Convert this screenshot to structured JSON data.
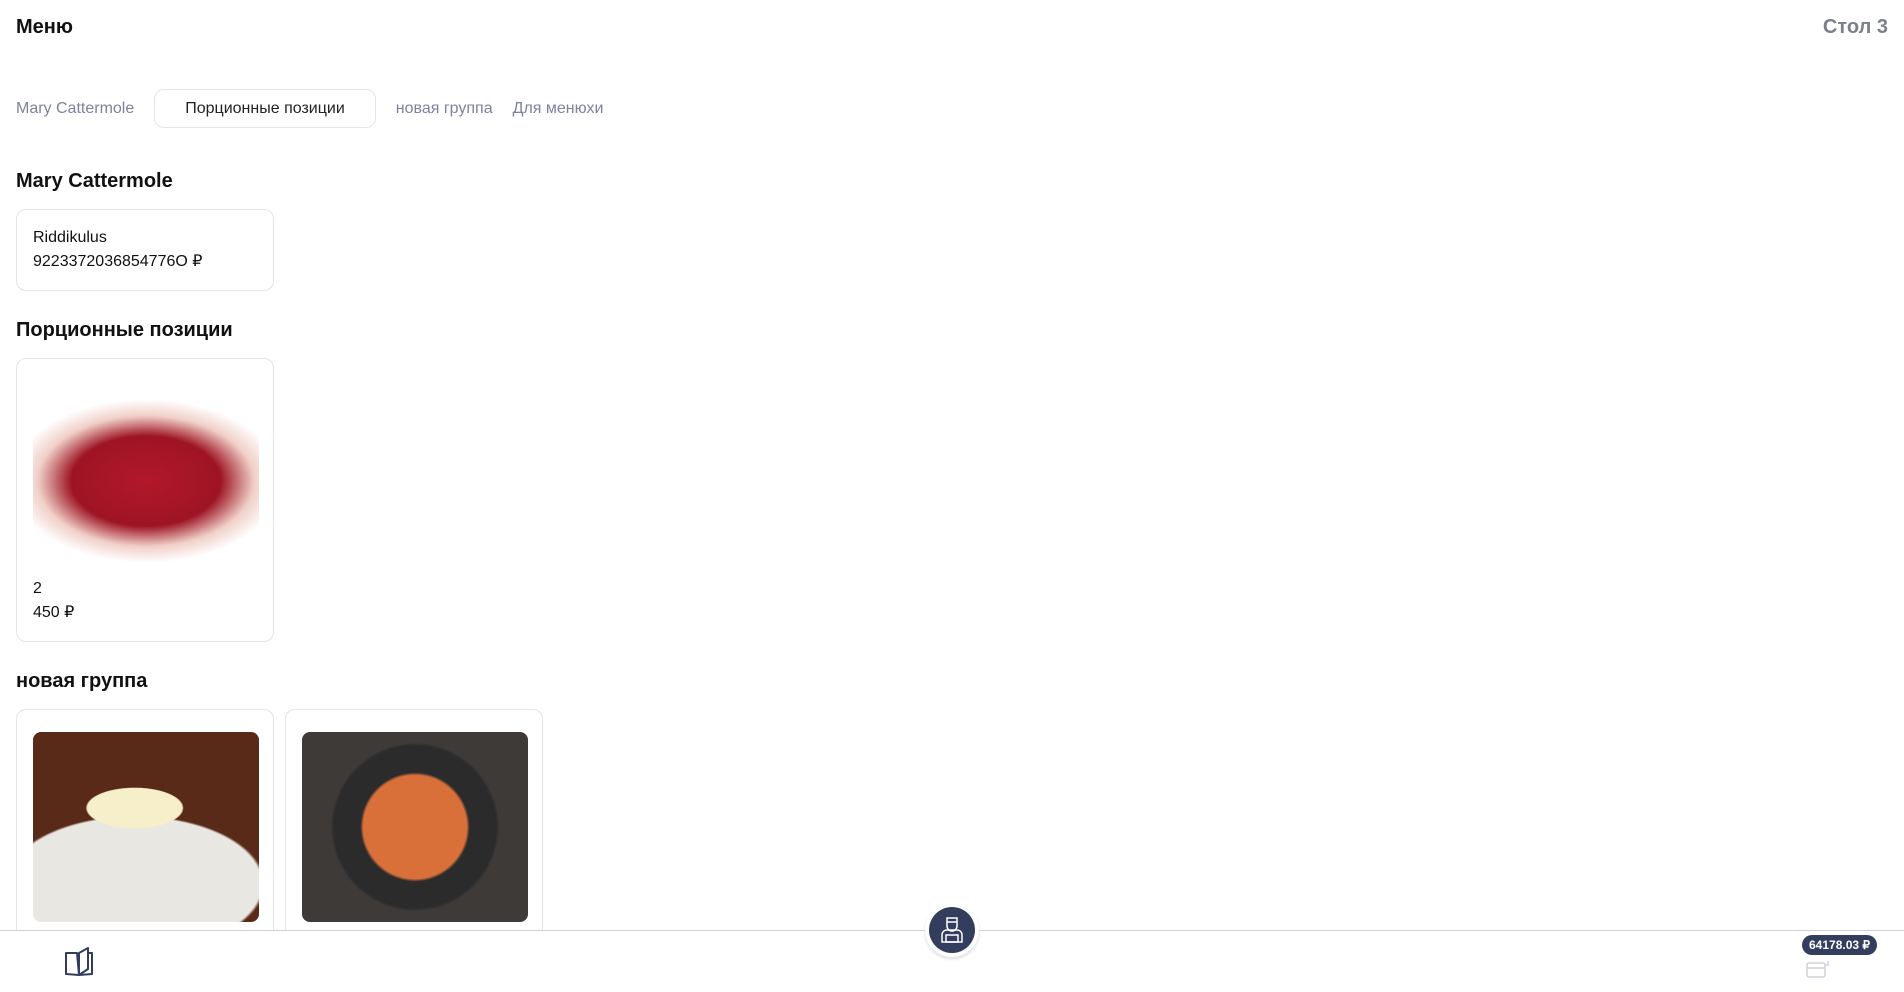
{
  "header": {
    "title": "Меню",
    "table": "Стол 3"
  },
  "tabs": [
    {
      "label": "Mary Cattermole"
    },
    {
      "label": "Порционные позиции",
      "active": true
    },
    {
      "label": "новая группа"
    },
    {
      "label": "Для менюхи"
    }
  ],
  "sections": [
    {
      "title": "Mary Cattermole",
      "items": [
        {
          "name": "Riddikulus",
          "price": "9223372036854776О ₽"
        }
      ]
    },
    {
      "title": "Порционные позиции",
      "items": [
        {
          "name": "2",
          "price": "450 ₽",
          "image": "raw-beef"
        }
      ]
    },
    {
      "title": "новая группа",
      "items": [
        {
          "image": "cheese-dish"
        },
        {
          "image": "pasta-pan"
        }
      ]
    }
  ],
  "footer": {
    "total": "64178.03 ₽"
  },
  "colors": {
    "accent": "#333d5e",
    "muted": "#7c82a0"
  }
}
